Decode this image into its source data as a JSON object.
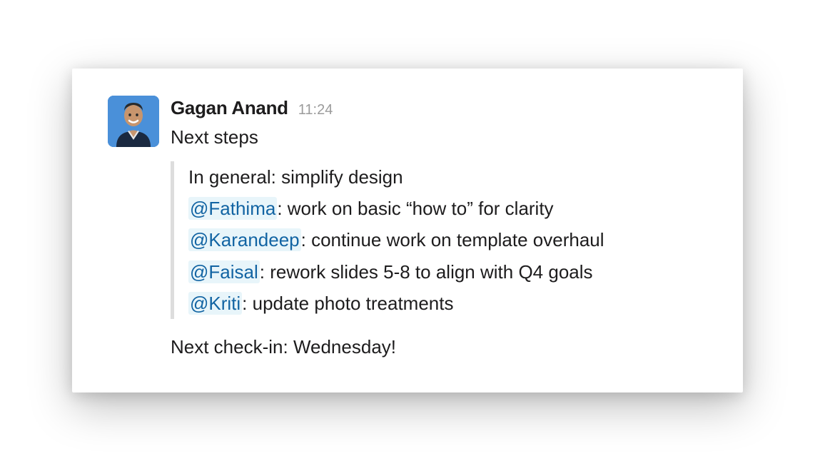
{
  "message": {
    "author": "Gagan Anand",
    "timestamp": "11:24",
    "intro_text": "Next steps",
    "quote": {
      "general_line": "In general: simplify design",
      "tasks": [
        {
          "mention": "@Fathima",
          "task": ": work on basic “how to” for clarity"
        },
        {
          "mention": "@Karandeep",
          "task": ": continue work on template overhaul"
        },
        {
          "mention": "@Faisal",
          "task": ": rework slides 5-8 to align with Q4 goals"
        },
        {
          "mention": "@Kriti",
          "task": ": update photo treatments"
        }
      ]
    },
    "footer_text": "Next check-in: Wednesday!"
  },
  "colors": {
    "mention_text": "#1264a3",
    "mention_bg": "#e8f5fa",
    "text_primary": "#1d1c1d",
    "timestamp": "#9b9b9b",
    "quote_border": "#dddddd"
  }
}
